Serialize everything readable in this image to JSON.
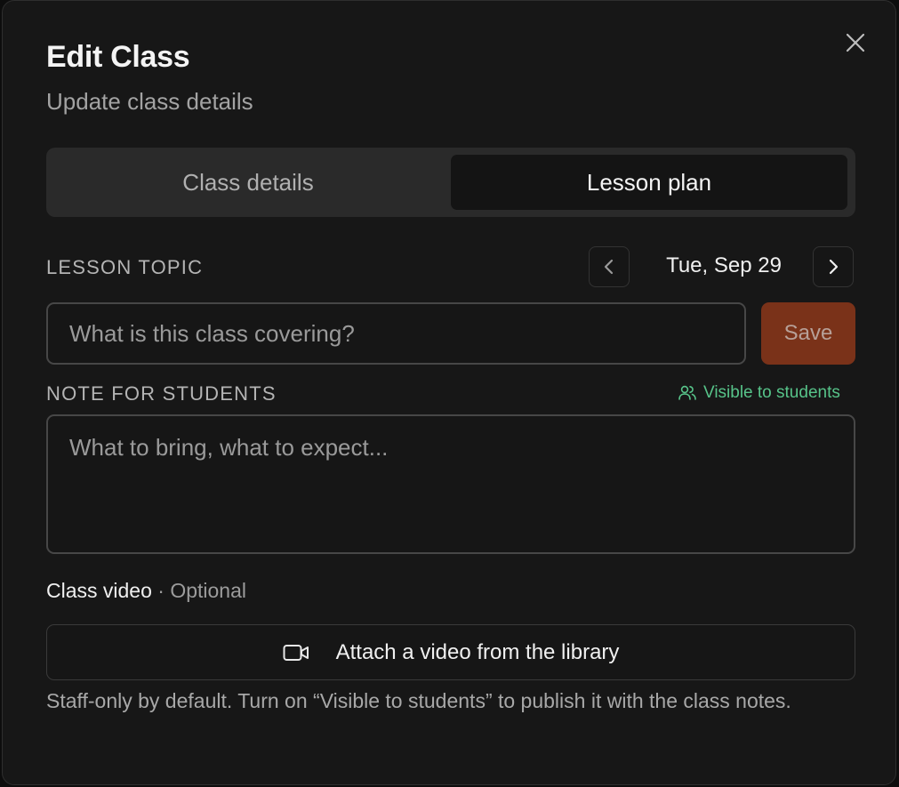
{
  "modal": {
    "title": "Edit Class",
    "subtitle": "Update class details",
    "close_icon": "close-icon"
  },
  "tabs": [
    {
      "label": "Class details",
      "active": false
    },
    {
      "label": "Lesson plan",
      "active": true
    }
  ],
  "lesson_topic": {
    "label": "LESSON TOPIC",
    "date": "Tue, Sep 29",
    "prev_icon": "chevron-left-icon",
    "next_icon": "chevron-right-icon",
    "placeholder": "What is this class covering?",
    "value": "",
    "save_label": "Save"
  },
  "note": {
    "label": "NOTE FOR STUDENTS",
    "visibility": "Visible to students",
    "visibility_icon": "users-icon",
    "placeholder": "What to bring, what to expect...",
    "value": ""
  },
  "video": {
    "label": "Class video",
    "optional": "· Optional",
    "attach_label": "Attach a video from the library",
    "attach_icon": "video-camera-icon",
    "help": "Staff-only by default. Turn on “Visible to students” to publish it with the class notes."
  },
  "colors": {
    "accent_save": "#7a3219",
    "visible_green": "#57c389",
    "background": "#171717"
  }
}
